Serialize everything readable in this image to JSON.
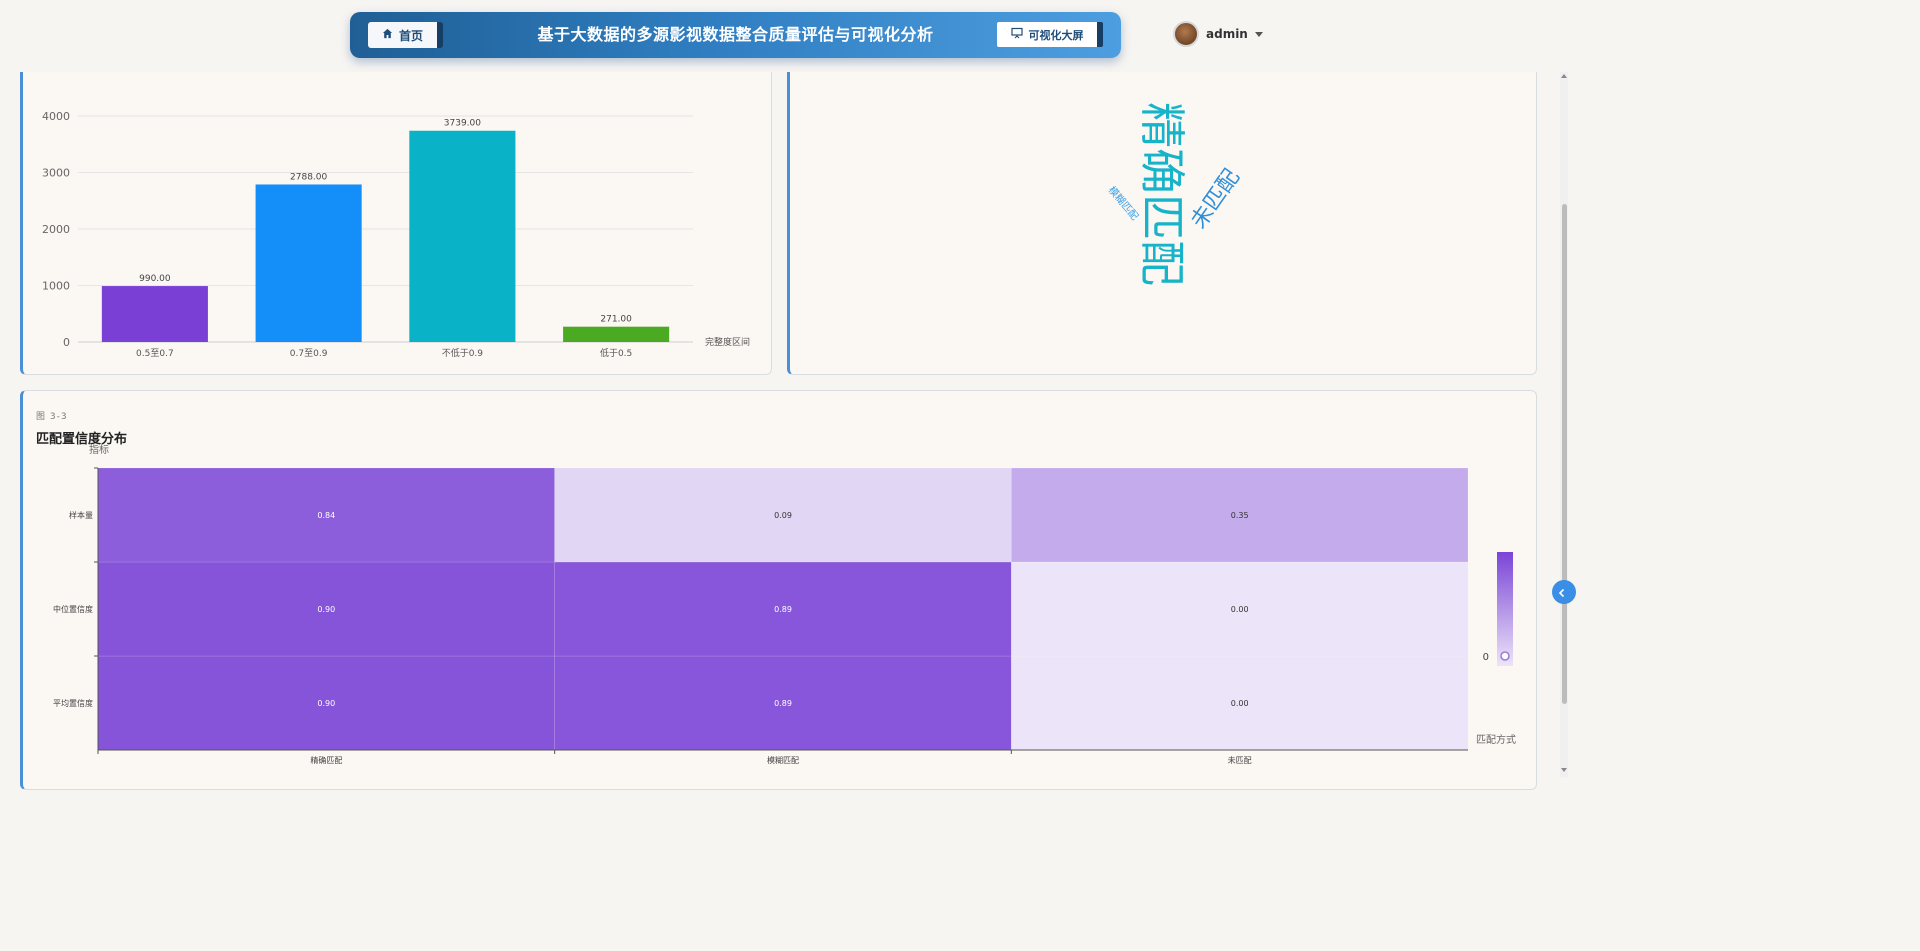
{
  "header": {
    "home_label": "首页",
    "title": "基于大数据的多源影视数据整合质量评估与可视化分析",
    "screen_label": "可视化大屏",
    "username": "admin"
  },
  "bar_panel": {
    "x_axis_name": "完整度区间",
    "y_ticks": [
      "0",
      "1000",
      "2000",
      "3000",
      "4000"
    ]
  },
  "word_cloud": {
    "words": [
      {
        "text": "精确匹配",
        "color": "#17b3c8"
      },
      {
        "text": "未匹配",
        "color": "#2f8fd8"
      },
      {
        "text": "模糊匹配",
        "color": "#3aa0e8"
      }
    ]
  },
  "heatmap_panel": {
    "figure_number": "图 3-3",
    "title": "匹配置信度分布",
    "y_axis_name": "指标",
    "x_axis_name": "匹配方式",
    "visual_map_min": "0"
  },
  "colors": {
    "accent": "#4a90d9",
    "heat_high": "#7a44d6",
    "heat_low": "#ece4f8"
  },
  "chart_data": [
    {
      "type": "bar",
      "categories": [
        "0.5至0.7",
        "0.7至0.9",
        "不低于0.9",
        "低于0.5"
      ],
      "values": [
        990,
        2788,
        3739,
        271
      ],
      "value_labels": [
        "990.00",
        "2788.00",
        "3739.00",
        "271.00"
      ],
      "bar_colors": [
        "#7a3fd4",
        "#148ef8",
        "#0ab2c8",
        "#4aab22"
      ],
      "xlabel": "完整度区间",
      "ylabel": "",
      "ylim": [
        0,
        4000
      ],
      "grid": true
    },
    {
      "type": "heatmap",
      "x_categories": [
        "精确匹配",
        "模糊匹配",
        "未匹配"
      ],
      "y_categories": [
        "平均置信度",
        "中位置信度",
        "样本量"
      ],
      "values": [
        [
          0.9,
          0.89,
          0.0
        ],
        [
          0.9,
          0.89,
          0.0
        ],
        [
          0.84,
          0.09,
          0.35
        ]
      ],
      "value_labels": [
        [
          "0.90",
          "0.89",
          "0.00"
        ],
        [
          "0.90",
          "0.89",
          "0.00"
        ],
        [
          "0.84",
          "0.09",
          "0.35"
        ]
      ],
      "xlabel": "匹配方式",
      "ylabel": "指标",
      "range": [
        0,
        1
      ]
    }
  ]
}
